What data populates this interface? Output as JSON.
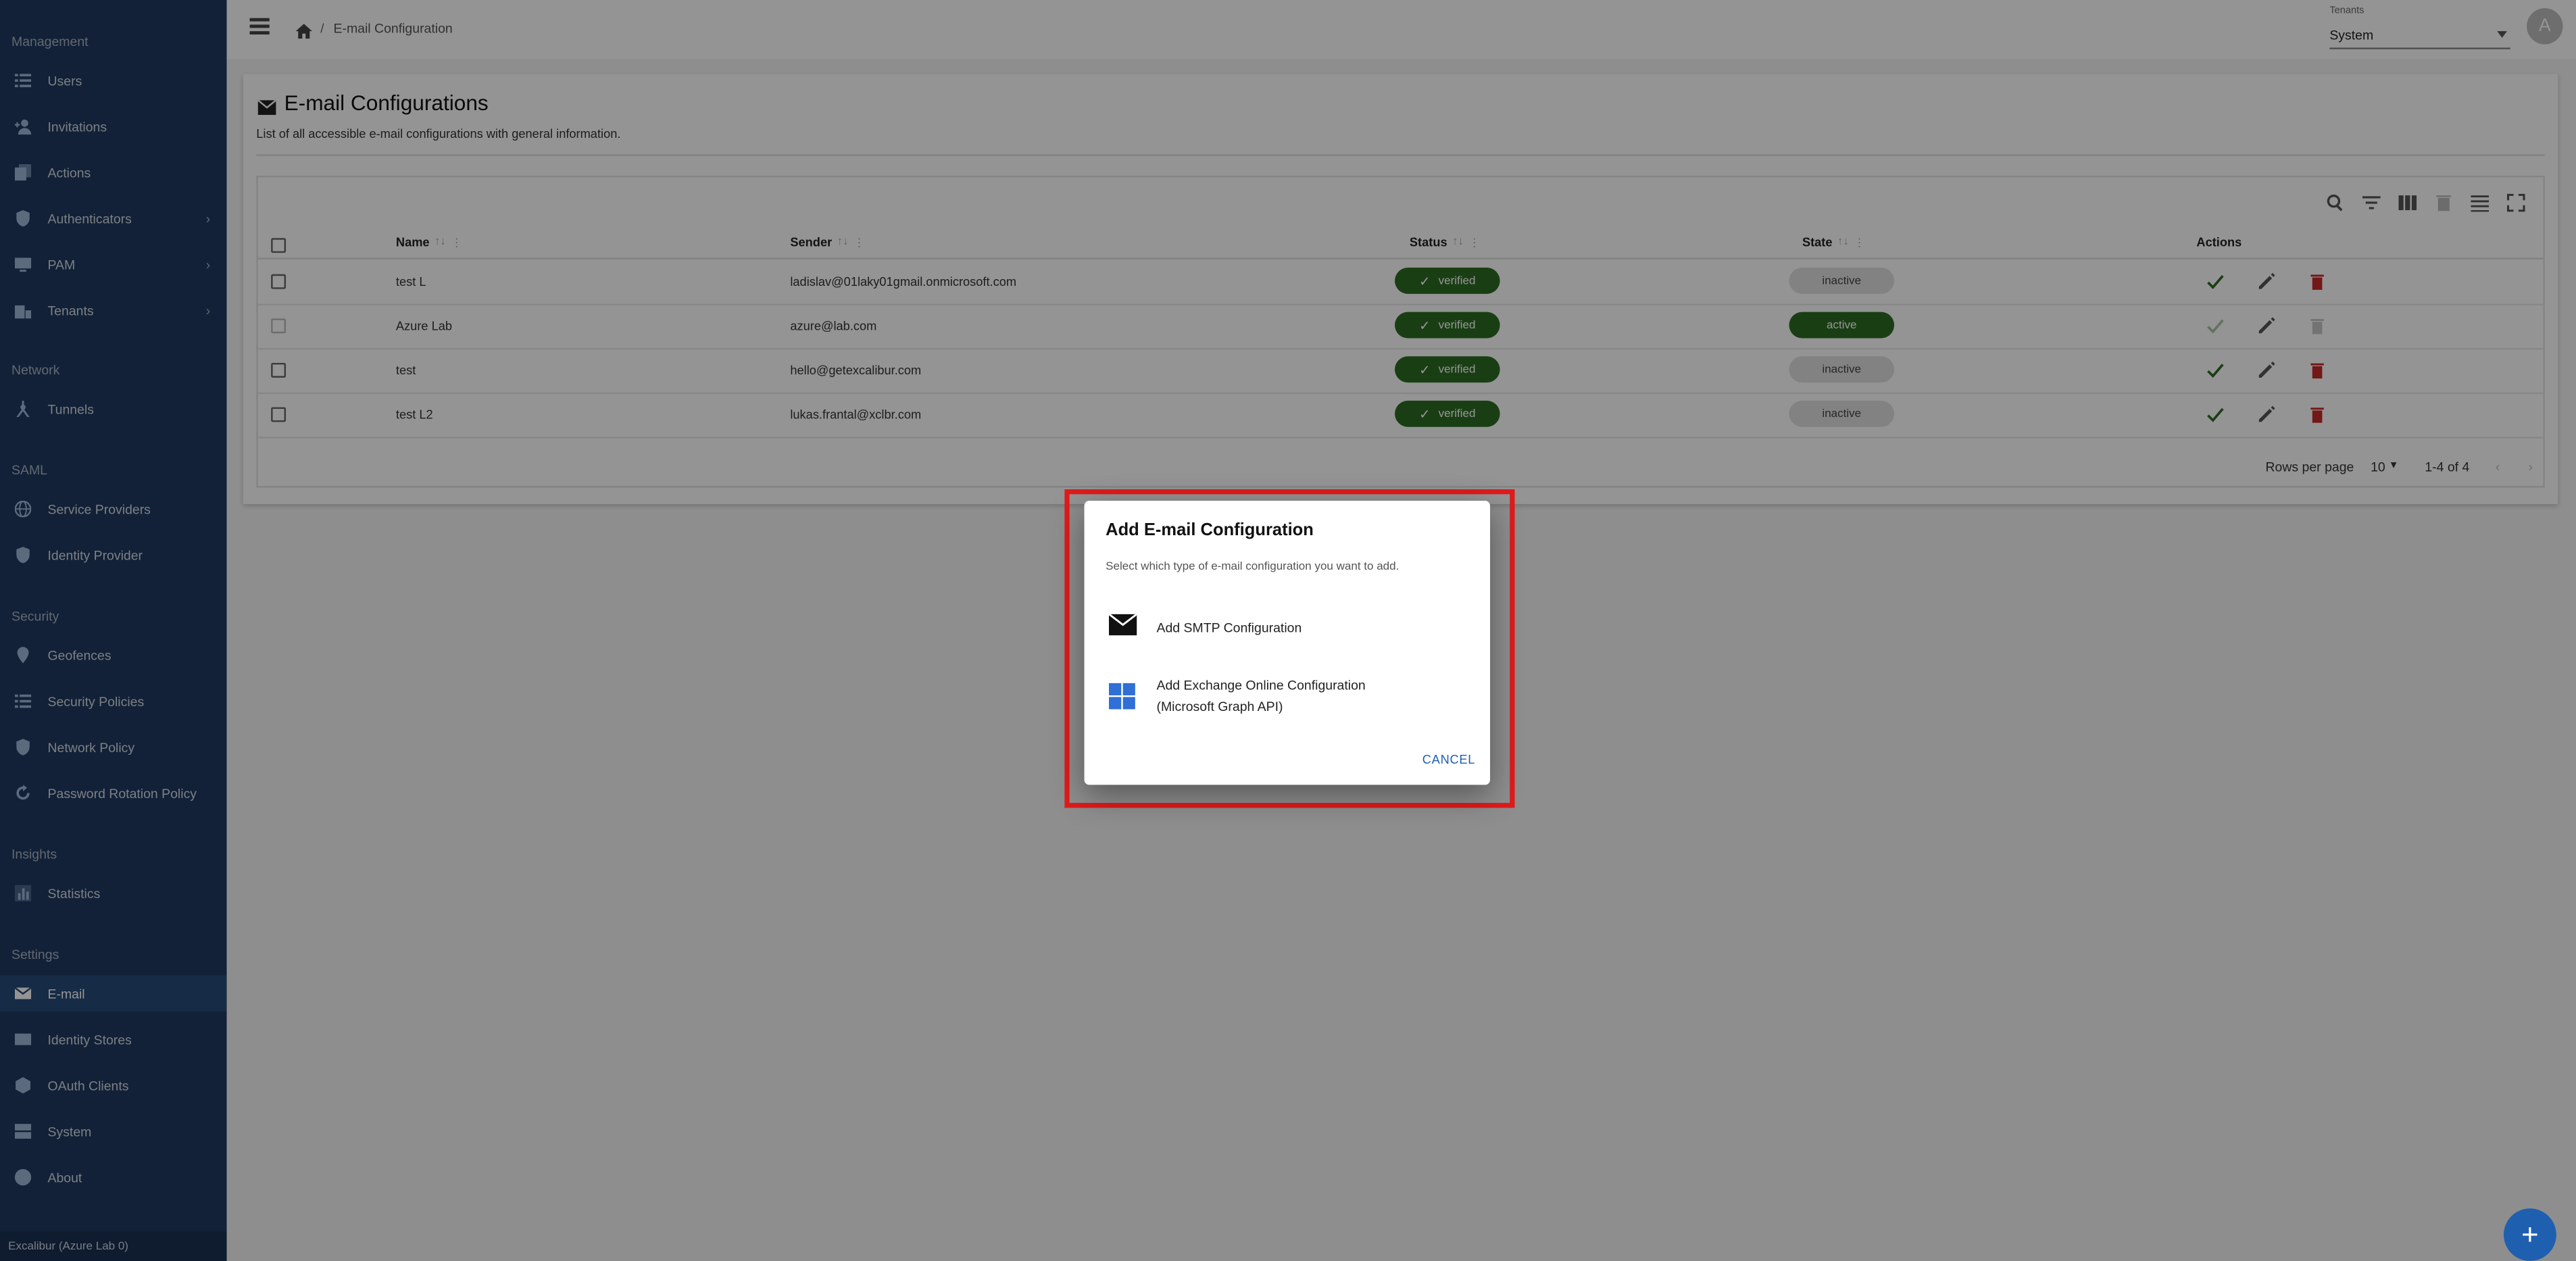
{
  "sidebar": {
    "sections": [
      {
        "title": "Management",
        "items": [
          {
            "label": "Users",
            "icon": "list-icon"
          },
          {
            "label": "Invitations",
            "icon": "person-add-icon"
          },
          {
            "label": "Actions",
            "icon": "library-icon"
          },
          {
            "label": "Authenticators",
            "icon": "shield-check-icon",
            "expandable": true
          },
          {
            "label": "PAM",
            "icon": "monitor-icon",
            "expandable": true
          },
          {
            "label": "Tenants",
            "icon": "building-icon",
            "expandable": true
          }
        ]
      },
      {
        "title": "Network",
        "items": [
          {
            "label": "Tunnels",
            "icon": "tunnel-hub-icon"
          }
        ]
      },
      {
        "title": "SAML",
        "items": [
          {
            "label": "Service Providers",
            "icon": "globe-icon"
          },
          {
            "label": "Identity Provider",
            "icon": "shield-icon"
          }
        ]
      },
      {
        "title": "Security",
        "items": [
          {
            "label": "Geofences",
            "icon": "location-pin-icon"
          },
          {
            "label": "Security Policies",
            "icon": "list-icon"
          },
          {
            "label": "Network Policy",
            "icon": "shield-network-icon"
          },
          {
            "label": "Password Rotation Policy",
            "icon": "rotate-key-icon"
          }
        ]
      },
      {
        "title": "Insights",
        "items": [
          {
            "label": "Statistics",
            "icon": "bar-chart-icon"
          }
        ]
      },
      {
        "title": "Settings",
        "items": [
          {
            "label": "E-mail",
            "icon": "mail-icon",
            "active": true
          },
          {
            "label": "Identity Stores",
            "icon": "id-card-icon"
          },
          {
            "label": "OAuth Clients",
            "icon": "cube-icon"
          },
          {
            "label": "System",
            "icon": "server-icon"
          },
          {
            "label": "About",
            "icon": "help-icon"
          }
        ]
      }
    ],
    "footer": "Excalibur (Azure Lab 0)"
  },
  "topbar": {
    "breadcrumb_sep": "/",
    "breadcrumb_current": "E-mail Configuration",
    "tenant_label": "Tenants",
    "tenant_value": "System",
    "avatar_letter": "A"
  },
  "page": {
    "title": "E-mail Configurations",
    "subtitle": "List of all accessible e-mail configurations with general information."
  },
  "table": {
    "columns": {
      "name": "Name",
      "sender": "Sender",
      "status": "Status",
      "state": "State",
      "actions": "Actions"
    },
    "sort_glyph": "↑↓",
    "more_glyph": "⋮",
    "rows": [
      {
        "name": "test L",
        "sender": "ladislav@01laky01gmail.onmicrosoft.com",
        "status": "verified",
        "state": "inactive"
      },
      {
        "name": "Azure Lab",
        "sender": "azure@lab.com",
        "status": "verified",
        "state": "active"
      },
      {
        "name": "test",
        "sender": "hello@getexcalibur.com",
        "status": "verified",
        "state": "inactive"
      },
      {
        "name": "test L2",
        "sender": "lukas.frantal@xclbr.com",
        "status": "verified",
        "state": "inactive"
      }
    ],
    "pager": {
      "rows_label": "Rows per page",
      "rows_value": "10",
      "range": "1-4 of 4"
    }
  },
  "dialog": {
    "title": "Add E-mail Configuration",
    "subtitle": "Select which type of e-mail configuration you want to add.",
    "option_smtp": "Add SMTP Configuration",
    "option_exchange_line1": "Add Exchange Online Configuration",
    "option_exchange_line2": "(Microsoft Graph API)",
    "cancel": "CANCEL"
  },
  "fab_label": "+",
  "colors": {
    "sidebar": "#1f3a60",
    "accent": "#1f5fb0",
    "verified": "#2e6b23",
    "highlight": "#e01b1b",
    "danger": "#c62828"
  }
}
